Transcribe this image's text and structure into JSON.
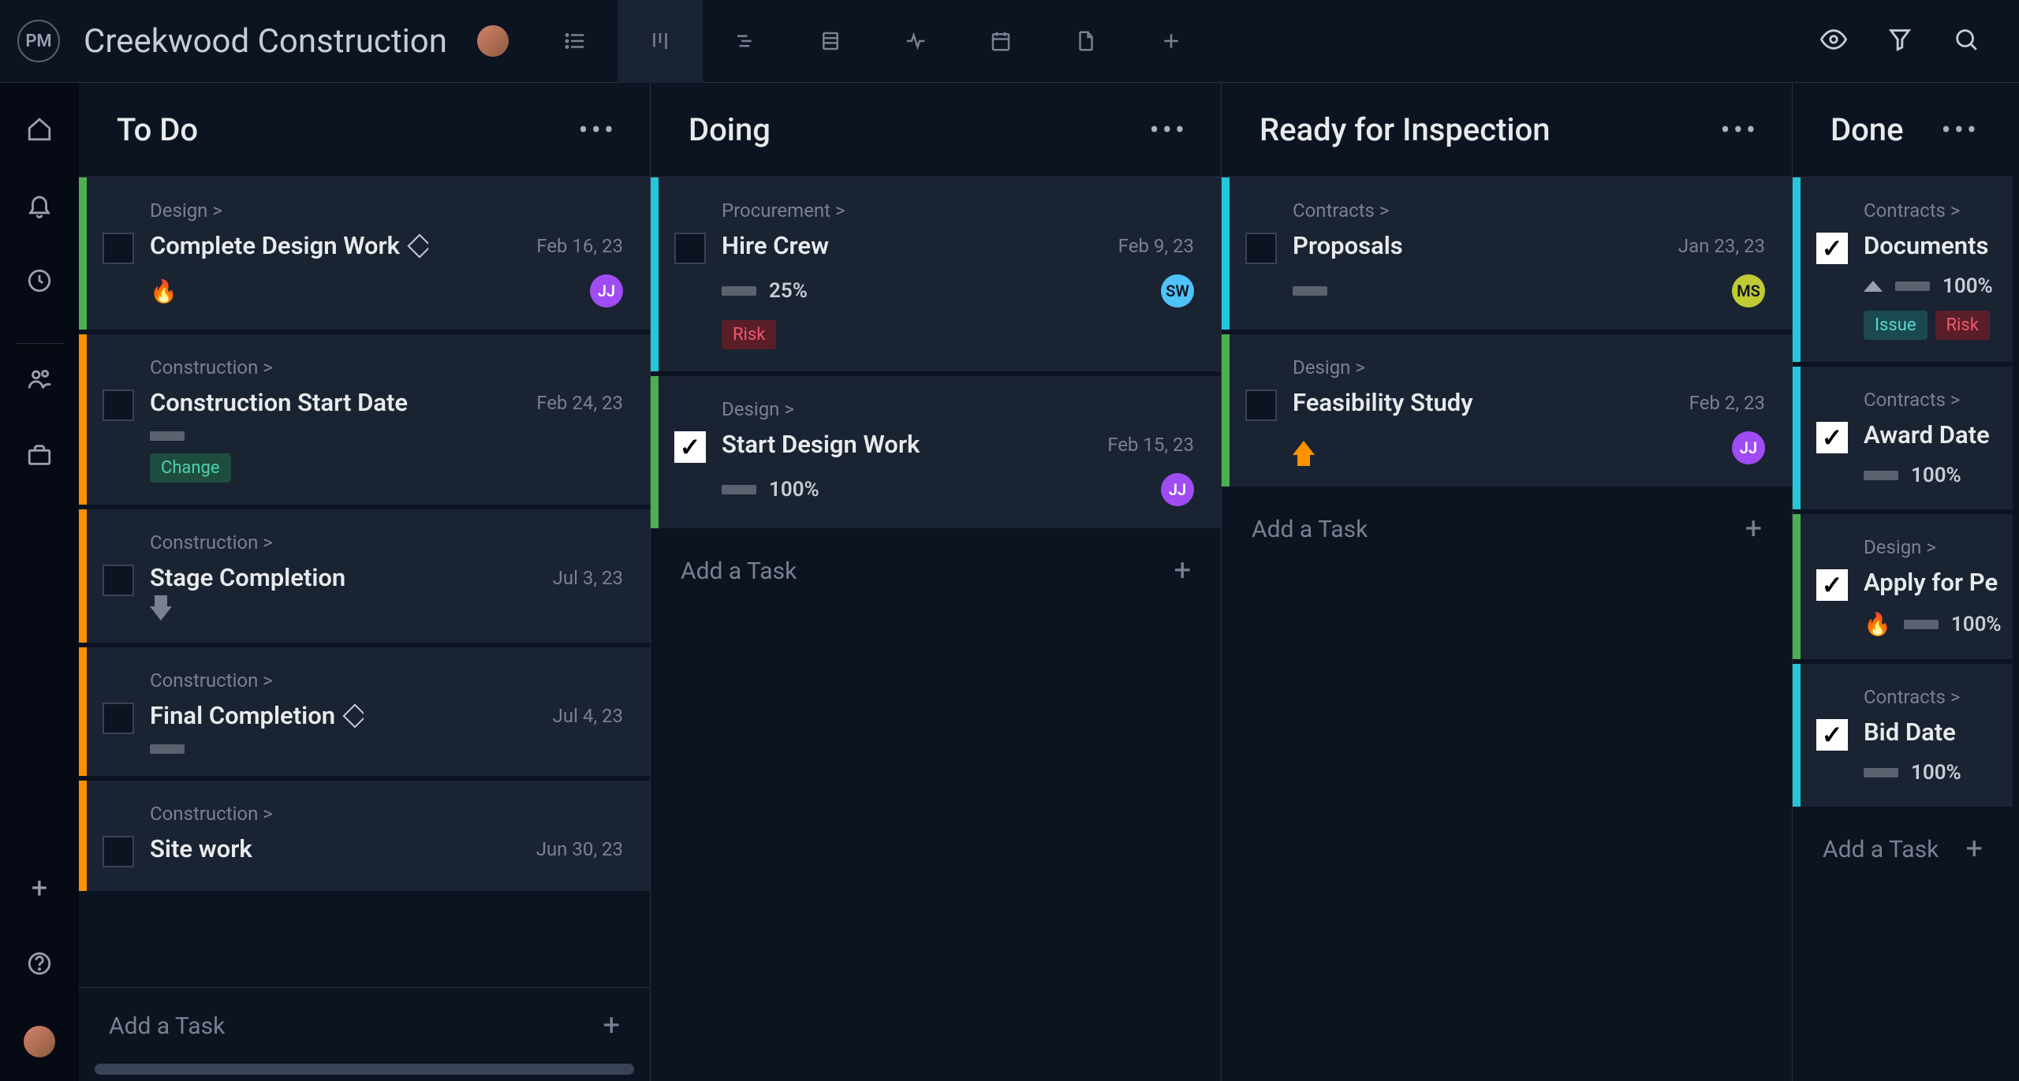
{
  "logo_text": "PM",
  "project_title": "Creekwood Construction",
  "columns": [
    {
      "title": "To Do",
      "cards": [
        {
          "category": "Design >",
          "title": "Complete Design Work",
          "date": "Feb 16, 23",
          "stripe": "green",
          "checked": false,
          "has_diamond": true,
          "has_fire": true,
          "avatar": {
            "text": "JJ",
            "cls": "av-purple"
          }
        },
        {
          "category": "Construction >",
          "title": "Construction Start Date",
          "date": "Feb 24, 23",
          "stripe": "orange",
          "checked": false,
          "has_progress_bar_only": true,
          "tags": [
            {
              "label": "Change",
              "cls": "tag-change"
            }
          ]
        },
        {
          "category": "Construction >",
          "title": "Stage Completion",
          "date": "Jul 3, 23",
          "stripe": "orange",
          "checked": false,
          "has_arrow_down": true
        },
        {
          "category": "Construction >",
          "title": "Final Completion",
          "date": "Jul 4, 23",
          "stripe": "orange",
          "checked": false,
          "has_diamond": true,
          "has_progress_bar_only": true
        },
        {
          "category": "Construction >",
          "title": "Site work",
          "date": "Jun 30, 23",
          "stripe": "orange",
          "checked": false
        }
      ],
      "add_label": "Add a Task",
      "has_footer_add": true
    },
    {
      "title": "Doing",
      "cards": [
        {
          "category": "Procurement >",
          "title": "Hire Crew",
          "date": "Feb 9, 23",
          "stripe": "cyan",
          "checked": false,
          "progress": "25%",
          "avatar": {
            "text": "SW",
            "cls": "av-blue"
          },
          "tags": [
            {
              "label": "Risk",
              "cls": "tag-risk"
            }
          ]
        },
        {
          "category": "Design >",
          "title": "Start Design Work",
          "date": "Feb 15, 23",
          "stripe": "green",
          "checked": true,
          "progress": "100%",
          "avatar": {
            "text": "JJ",
            "cls": "av-purple"
          }
        }
      ],
      "add_label": "Add a Task"
    },
    {
      "title": "Ready for Inspection",
      "cards": [
        {
          "category": "Contracts >",
          "title": "Proposals",
          "date": "Jan 23, 23",
          "stripe": "cyan",
          "checked": false,
          "has_progress_bar_only": true,
          "avatar": {
            "text": "MS",
            "cls": "av-olive"
          }
        },
        {
          "category": "Design >",
          "title": "Feasibility Study",
          "date": "Feb 2, 23",
          "stripe": "green",
          "checked": false,
          "has_arrow_up_orange": true,
          "avatar": {
            "text": "JJ",
            "cls": "av-purple"
          }
        }
      ],
      "add_label": "Add a Task"
    },
    {
      "title": "Done",
      "cards": [
        {
          "category": "Contracts >",
          "title": "Documents",
          "stripe": "cyan",
          "checked": true,
          "has_arrow_up_gray": true,
          "progress": "100%",
          "tags": [
            {
              "label": "Issue",
              "cls": "tag-issue"
            },
            {
              "label": "Risk",
              "cls": "tag-risk"
            }
          ]
        },
        {
          "category": "Contracts >",
          "title": "Award Date",
          "stripe": "cyan",
          "checked": true,
          "progress": "100%"
        },
        {
          "category": "Design >",
          "title": "Apply for Pe",
          "stripe": "green",
          "checked": true,
          "has_fire": true,
          "progress": "100%"
        },
        {
          "category": "Contracts >",
          "title": "Bid Date",
          "stripe": "cyan",
          "checked": true,
          "progress": "100%"
        }
      ],
      "add_label": "Add a Task",
      "narrow": true
    }
  ]
}
